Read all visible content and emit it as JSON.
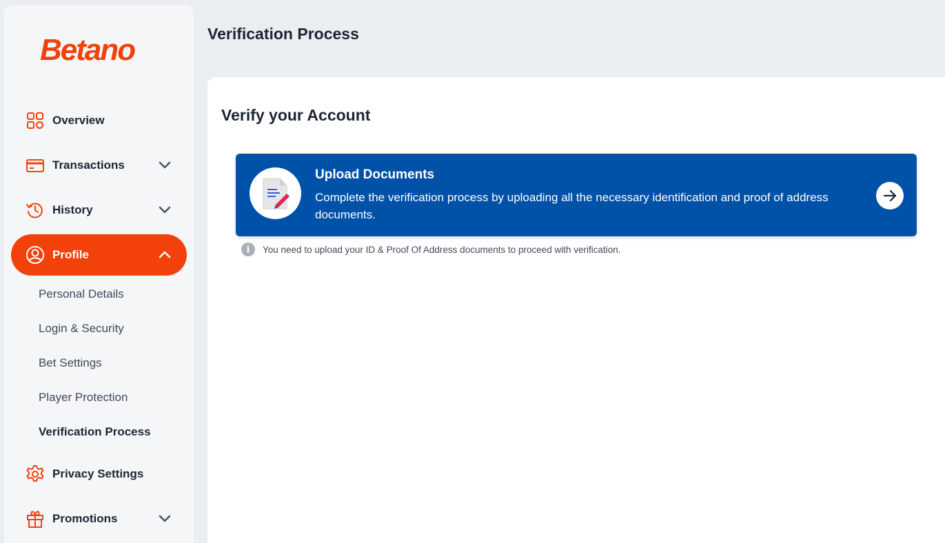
{
  "brand": {
    "logo_text": "Betano",
    "accent_color": "#f2410a",
    "primary_blue": "#0052a8"
  },
  "sidebar": {
    "items": [
      {
        "label": "Overview",
        "icon": "grid-icon",
        "expandable": false
      },
      {
        "label": "Transactions",
        "icon": "credit-card-icon",
        "expandable": true
      },
      {
        "label": "History",
        "icon": "history-icon",
        "expandable": true
      },
      {
        "label": "Profile",
        "icon": "user-icon",
        "expandable": true,
        "active": true
      },
      {
        "label": "Privacy Settings",
        "icon": "gear-icon",
        "expandable": false
      },
      {
        "label": "Promotions",
        "icon": "gift-icon",
        "expandable": true
      }
    ],
    "profile_subitems": [
      {
        "label": "Personal Details"
      },
      {
        "label": "Login & Security"
      },
      {
        "label": "Bet Settings"
      },
      {
        "label": "Player Protection"
      },
      {
        "label": "Verification Process",
        "current": true
      }
    ]
  },
  "header": {
    "title": "Verification Process"
  },
  "main": {
    "card_title": "Verify your Account",
    "upload": {
      "title": "Upload Documents",
      "description": "Complete the verification process by uploading all the necessary identification and proof of address documents.",
      "icon": "document-pen-icon",
      "action_icon": "arrow-right-icon"
    },
    "info_note": "You need to upload your ID & Proof Of Address documents to proceed with verification."
  }
}
